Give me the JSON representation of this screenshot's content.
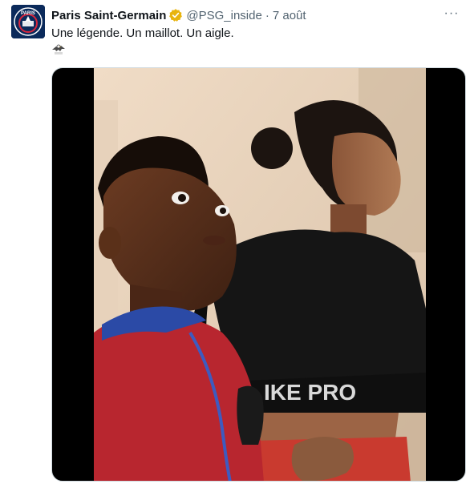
{
  "tweet": {
    "author_name": "Paris Saint-Germain",
    "handle": "@PSG_inside",
    "separator": "·",
    "date": "7 août",
    "more_label": "···",
    "text": "Une légende. Un maillot. Un aigle.",
    "emoji_icon": "eagle-emoji-icon",
    "verified_color": "#e8b40d"
  },
  "avatar": {
    "logo_top_text": "PARIS",
    "logo_color": "#0b2a5b"
  },
  "media": {
    "shirt_text": "IKE PRO"
  }
}
